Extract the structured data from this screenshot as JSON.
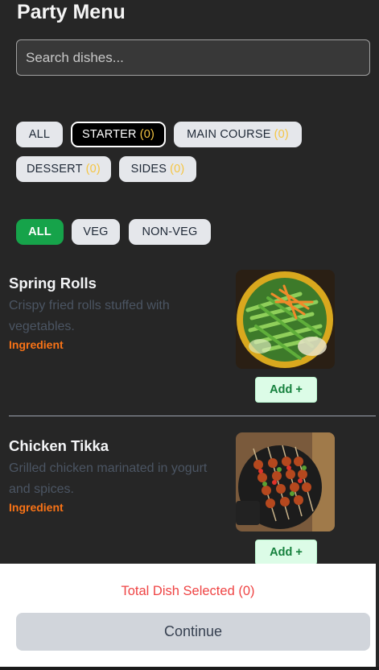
{
  "header": {
    "title": "Party Menu"
  },
  "search": {
    "placeholder": "Search dishes...",
    "value": ""
  },
  "category_tabs": [
    {
      "label": "ALL",
      "count": "",
      "active": false
    },
    {
      "label": "STARTER",
      "count": "(0)",
      "active": true
    },
    {
      "label": "MAIN COURSE",
      "count": "(0)",
      "active": false
    },
    {
      "label": "DESSERT",
      "count": "(0)",
      "active": false
    },
    {
      "label": "SIDES",
      "count": "(0)",
      "active": false
    }
  ],
  "diet_filters": [
    {
      "label": "ALL",
      "active": true
    },
    {
      "label": "VEG",
      "active": false
    },
    {
      "label": "NON-VEG",
      "active": false
    }
  ],
  "dishes": [
    {
      "name": "Spring Rolls",
      "description": "Crispy fried rolls stuffed with vegetables.",
      "ingredient_label": "Ingredient",
      "add_label": "Add +",
      "image_icon": "salad-bowl-photo"
    },
    {
      "name": "Chicken Tikka",
      "description": "Grilled chicken marinated in yogurt and spices.",
      "ingredient_label": "Ingredient",
      "add_label": "Add +",
      "image_icon": "skewers-photo"
    }
  ],
  "footer": {
    "total_label": "Total Dish Selected (0)",
    "continue_label": "Continue"
  },
  "colors": {
    "background": "#262626",
    "accent_green": "#16a34a",
    "count_yellow": "#f5c542",
    "ingredient_orange": "#f97316",
    "total_red": "#ef4444"
  }
}
